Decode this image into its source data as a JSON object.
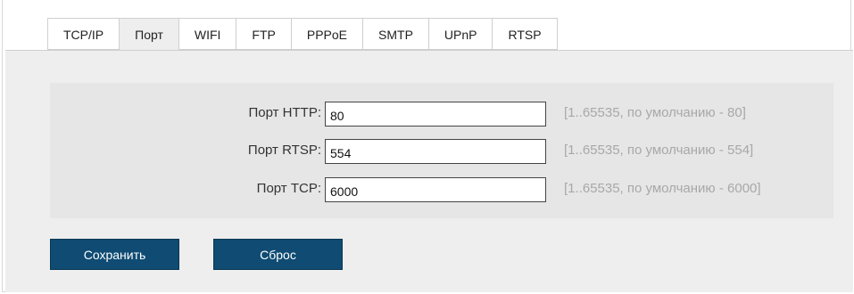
{
  "tabs": [
    {
      "label": "TCP/IP",
      "active": false
    },
    {
      "label": "Порт",
      "active": true
    },
    {
      "label": "WIFI",
      "active": false
    },
    {
      "label": "FTP",
      "active": false
    },
    {
      "label": "PPPoE",
      "active": false
    },
    {
      "label": "SMTP",
      "active": false
    },
    {
      "label": "UPnP",
      "active": false
    },
    {
      "label": "RTSP",
      "active": false
    }
  ],
  "form": {
    "http": {
      "label": "Порт HTTP:",
      "value": "80",
      "hint": "[1..65535, по умолчанию - 80]"
    },
    "rtsp": {
      "label": "Порт RTSP:",
      "value": "554",
      "hint": "[1..65535, по умолчанию - 554]"
    },
    "tcp": {
      "label": "Порт TCP:",
      "value": "6000",
      "hint": "[1..65535, по умолчанию - 6000]"
    }
  },
  "actions": {
    "save_label": "Сохранить",
    "reset_label": "Сброс"
  },
  "colors": {
    "button_bg": "#0f4b72",
    "panel_bg": "#eeeeee",
    "hint_text": "#a8a8a8"
  }
}
